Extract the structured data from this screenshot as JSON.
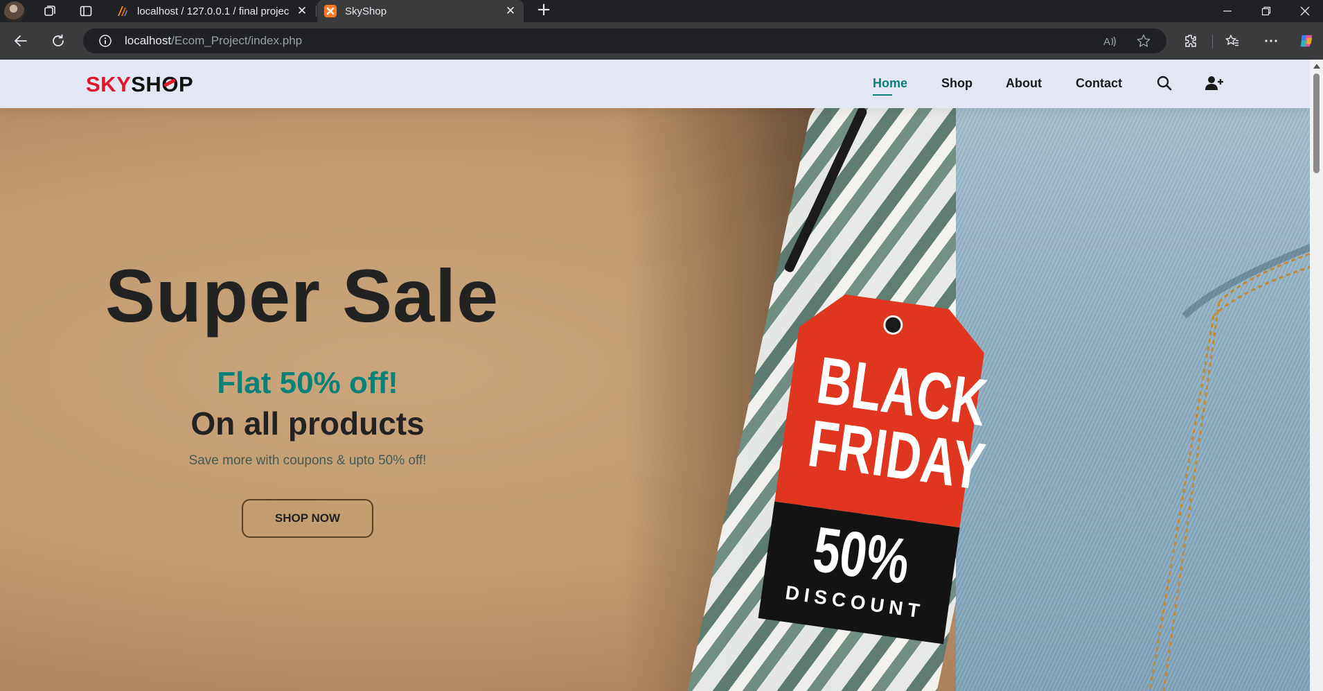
{
  "browser": {
    "tabs": [
      {
        "title": "localhost / 127.0.0.1 / final projec",
        "active": false
      },
      {
        "title": "SkyShop",
        "active": true
      }
    ],
    "address": {
      "host": "localhost",
      "path": "/Ecom_Project/index.php"
    }
  },
  "site": {
    "logo": {
      "sky": "SKY",
      "shop_a": "SH",
      "shop_o": "O",
      "shop_b": "P"
    },
    "nav": [
      {
        "label": "Home",
        "active": true
      },
      {
        "label": "Shop",
        "active": false
      },
      {
        "label": "About",
        "active": false
      },
      {
        "label": "Contact",
        "active": false
      }
    ],
    "accent_color": "#088178",
    "logo_red": "#e0172b"
  },
  "hero": {
    "headline": "Super Sale",
    "offer": "Flat 50% off!",
    "sub_headline": "On all products",
    "tagline": "Save more with coupons & upto 50% off!",
    "cta_label": "SHOP NOW",
    "tag": {
      "line1": "BLACK",
      "line2": "FRIDAY",
      "percent": "50%",
      "discount": "DISCOUNT"
    }
  }
}
